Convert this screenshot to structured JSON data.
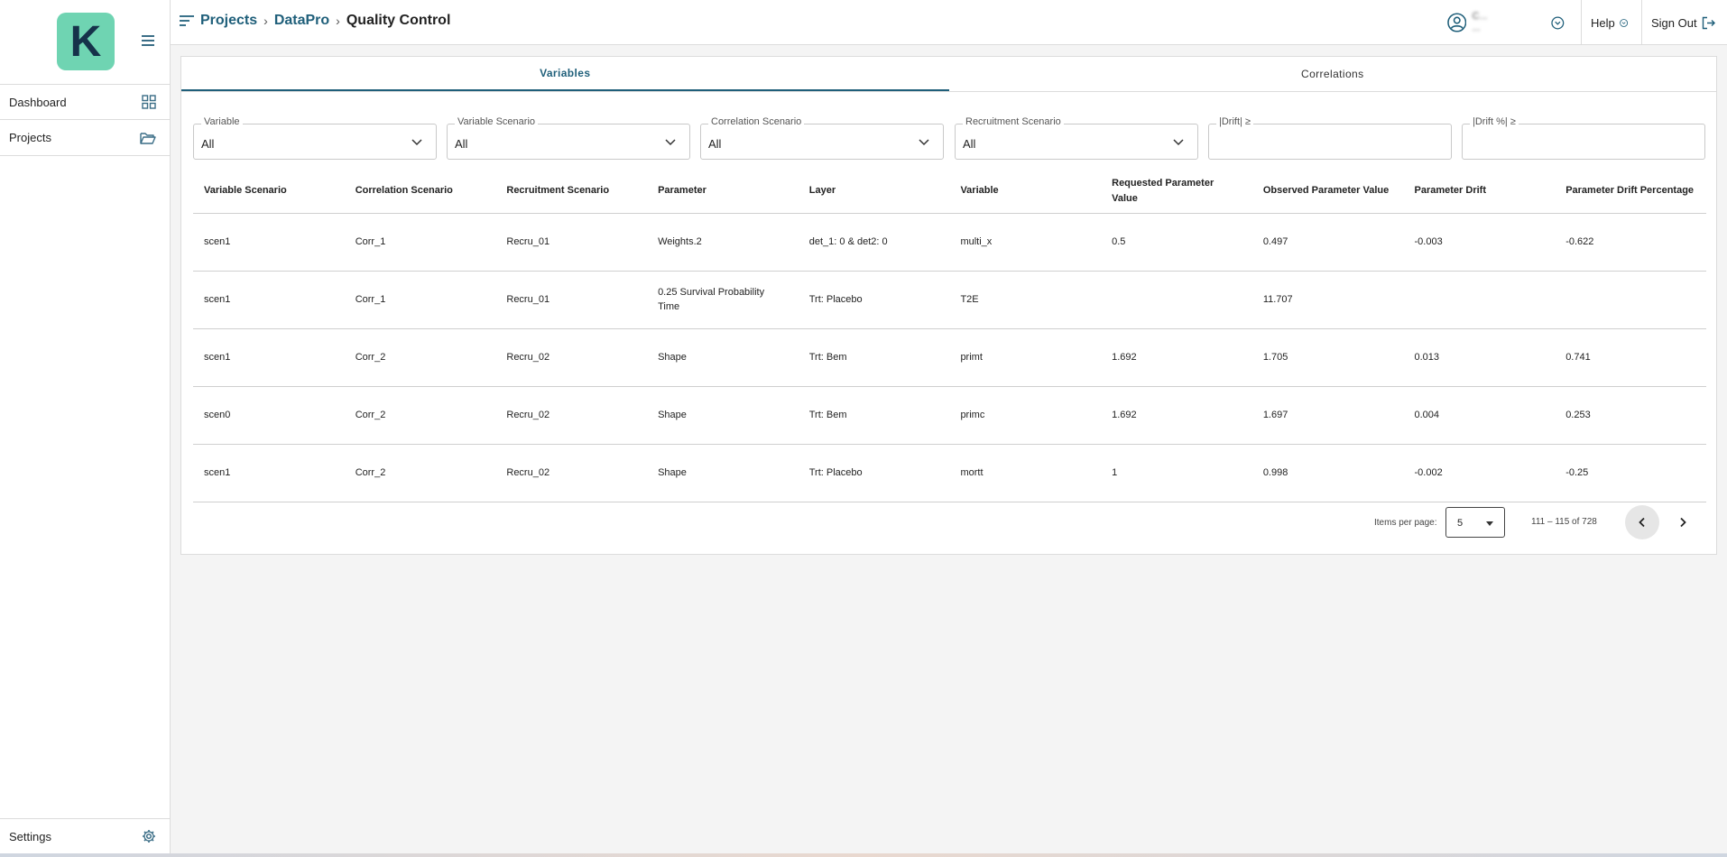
{
  "sidebar": {
    "logo_letter": "K",
    "items": [
      {
        "label": "Dashboard",
        "icon": "grid-icon"
      },
      {
        "label": "Projects",
        "icon": "folder-open-icon"
      }
    ],
    "settings_label": "Settings"
  },
  "header": {
    "breadcrumb": [
      "Projects",
      "DataPro",
      "Quality Control"
    ],
    "user_line1": "C...",
    "user_line2": "...",
    "help_label": "Help",
    "signout_label": "Sign Out"
  },
  "tabs": [
    "Variables",
    "Correlations"
  ],
  "filters": [
    {
      "label": "Variable",
      "value": "All"
    },
    {
      "label": "Variable Scenario",
      "value": "All"
    },
    {
      "label": "Correlation Scenario",
      "value": "All"
    },
    {
      "label": "Recruitment Scenario",
      "value": "All"
    },
    {
      "label": "|Drift| ≥",
      "value": ""
    },
    {
      "label": "|Drift %| ≥",
      "value": ""
    }
  ],
  "table": {
    "headers": [
      "Variable Scenario",
      "Correlation Scenario",
      "Recruitment Scenario",
      "Parameter",
      "Layer",
      "Variable",
      "Requested Parameter Value",
      "Observed Parameter Value",
      "Parameter Drift",
      "Parameter Drift Percentage"
    ],
    "rows": [
      [
        "scen1",
        "Corr_1",
        "Recru_01",
        "Weights.2",
        "det_1: 0 & det2: 0",
        "multi_x",
        "0.5",
        "0.497",
        "-0.003",
        "-0.622"
      ],
      [
        "scen1",
        "Corr_1",
        "Recru_01",
        "0.25 Survival Probability Time",
        "Trt: Placebo",
        "T2E",
        "",
        "11.707",
        "",
        ""
      ],
      [
        "scen1",
        "Corr_2",
        "Recru_02",
        "Shape",
        "Trt: Bem",
        "primt",
        "1.692",
        "1.705",
        "0.013",
        "0.741"
      ],
      [
        "scen0",
        "Corr_2",
        "Recru_02",
        "Shape",
        "Trt: Bem",
        "primc",
        "1.692",
        "1.697",
        "0.004",
        "0.253"
      ],
      [
        "scen1",
        "Corr_2",
        "Recru_02",
        "Shape",
        "Trt: Placebo",
        "mortt",
        "1",
        "0.998",
        "-0.002",
        "-0.25"
      ]
    ]
  },
  "paginator": {
    "items_per_page_label": "Items per page:",
    "items_per_page": "5",
    "range": "111 – 115 of 728"
  },
  "colors": {
    "accent": "#1f5f7a",
    "logo_bg": "#6fd4b2",
    "logo_fg": "#16324a"
  }
}
